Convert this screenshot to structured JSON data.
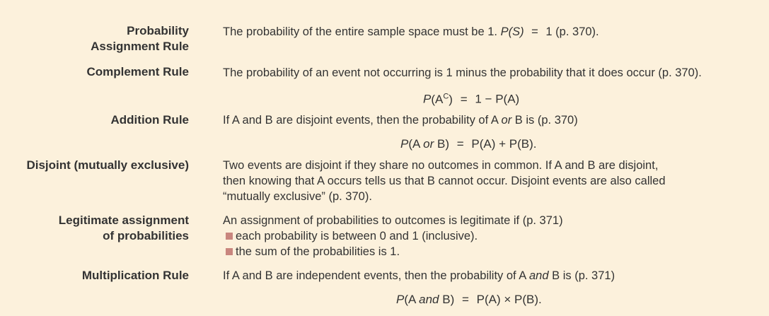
{
  "rules": {
    "probability_assignment": {
      "term_line1": "Probability",
      "term_line2": "Assignment Rule",
      "def_text": "The probability of the entire sample space must be 1.",
      "formula_lhs": "P(S)",
      "formula_op": "=",
      "formula_rhs": "1",
      "ref": "(p. 370)."
    },
    "complement": {
      "term": "Complement Rule",
      "def_text": "The probability of an event not occurring is 1 minus the probability that it does occur (p. 370).",
      "formula_lhs": "P(A",
      "formula_sup": "C",
      "formula_lhs_close": ")",
      "formula_op": "=",
      "formula_rhs": "1 − P(A)"
    },
    "addition": {
      "term": "Addition Rule",
      "def_pre": "If A and B are disjoint events, then the probability of A ",
      "def_italic": "or",
      "def_post": " B is (p. 370)",
      "formula_p": "P(A ",
      "formula_italic": "or",
      "formula_close": " B)",
      "formula_op": "=",
      "formula_rhs": "P(A) + P(B)."
    },
    "disjoint": {
      "term": "Disjoint (mutually exclusive)",
      "def_line1": "Two events are disjoint if they share no outcomes in common. If A and B are disjoint,",
      "def_line2": "then knowing that A occurs tells us that B cannot occur. Disjoint events are also called",
      "def_line3": "“mutually exclusive” (p. 370)."
    },
    "legitimate": {
      "term_line1": "Legitimate assignment",
      "term_line2": "of probabilities",
      "def_intro": "An assignment of probabilities to outcomes is legitimate if (p. 371)",
      "bullets": [
        "each probability is between 0 and 1 (inclusive).",
        "the sum of the probabilities is 1."
      ]
    },
    "multiplication": {
      "term": "Multiplication Rule",
      "def_pre": "If A and B are independent events, then the probability of A ",
      "def_italic": "and",
      "def_post": " B is (p. 371)",
      "formula_p": "P(A ",
      "formula_italic": "and",
      "formula_close": " B)",
      "formula_op": "=",
      "formula_rhs": "P(A) × P(B)."
    }
  },
  "colors": {
    "background": "#fcf1dc",
    "text": "#333333",
    "bullet": "#c9867e"
  }
}
